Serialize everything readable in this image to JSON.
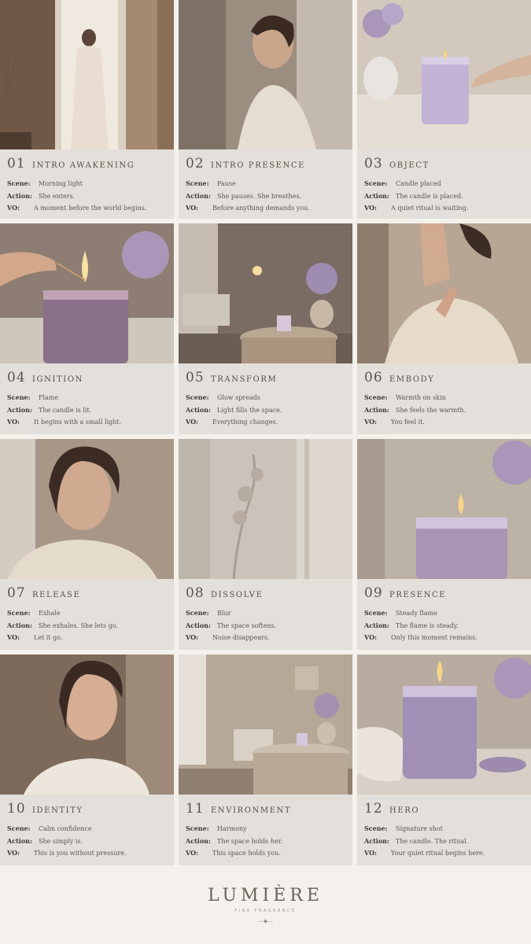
{
  "panels": [
    {
      "num": "01",
      "title": "INTRO AWAKENING",
      "scene": "Morning light",
      "action": "She enters.",
      "vo": "A moment before the world begins."
    },
    {
      "num": "02",
      "title": "INTRO PRESENCE",
      "scene": "Pause",
      "action": "She pauses. She breathes.",
      "vo": "Before anything demands you."
    },
    {
      "num": "03",
      "title": "OBJECT",
      "scene": "Candle placed",
      "action": "The candle is placed.",
      "vo": "A quiet ritual is waiting."
    },
    {
      "num": "04",
      "title": "IGNITION",
      "scene": "Flame",
      "action": "The candle is lit.",
      "vo": "It begins with a small light."
    },
    {
      "num": "05",
      "title": "TRANSFORM",
      "scene": "Glow spreads",
      "action": "Light fills the space.",
      "vo": "Everything changes."
    },
    {
      "num": "06",
      "title": "EMBODY",
      "scene": "Warmth on skin",
      "action": "She feels the warmth.",
      "vo": "You feel it."
    },
    {
      "num": "07",
      "title": "RELEASE",
      "scene": "Exhale",
      "action": "She exhales. She lets go.",
      "vo": "Let it go."
    },
    {
      "num": "08",
      "title": "DISSOLVE",
      "scene": "Blur",
      "action": "The space softens.",
      "vo": "Noise disappears."
    },
    {
      "num": "09",
      "title": "PRESENCE",
      "scene": "Steady flame",
      "action": "The flame is steady.",
      "vo": "Only this moment remains."
    },
    {
      "num": "10",
      "title": "IDENTITY",
      "scene": "Calm confidence",
      "action": "She simply is.",
      "vo": "This is you without pressure."
    },
    {
      "num": "11",
      "title": "ENVIRONMENT",
      "scene": "Harmony",
      "action": "The space holds her.",
      "vo": "This space holds you."
    },
    {
      "num": "12",
      "title": "HERO",
      "scene": "Signature shot",
      "action": "The candle. The ritual.",
      "vo": "Your quiet ritual begins here."
    }
  ],
  "labels": {
    "scene": "Scene:",
    "action": "Action:",
    "vo": "VO:"
  },
  "brand": {
    "name": "LUMIÈRE",
    "tagline": "FINE FRAGRANCE"
  },
  "colors": {
    "background": "#f4f1ec",
    "caption": "#e3dfda",
    "lavender": "#b7a6c9"
  }
}
